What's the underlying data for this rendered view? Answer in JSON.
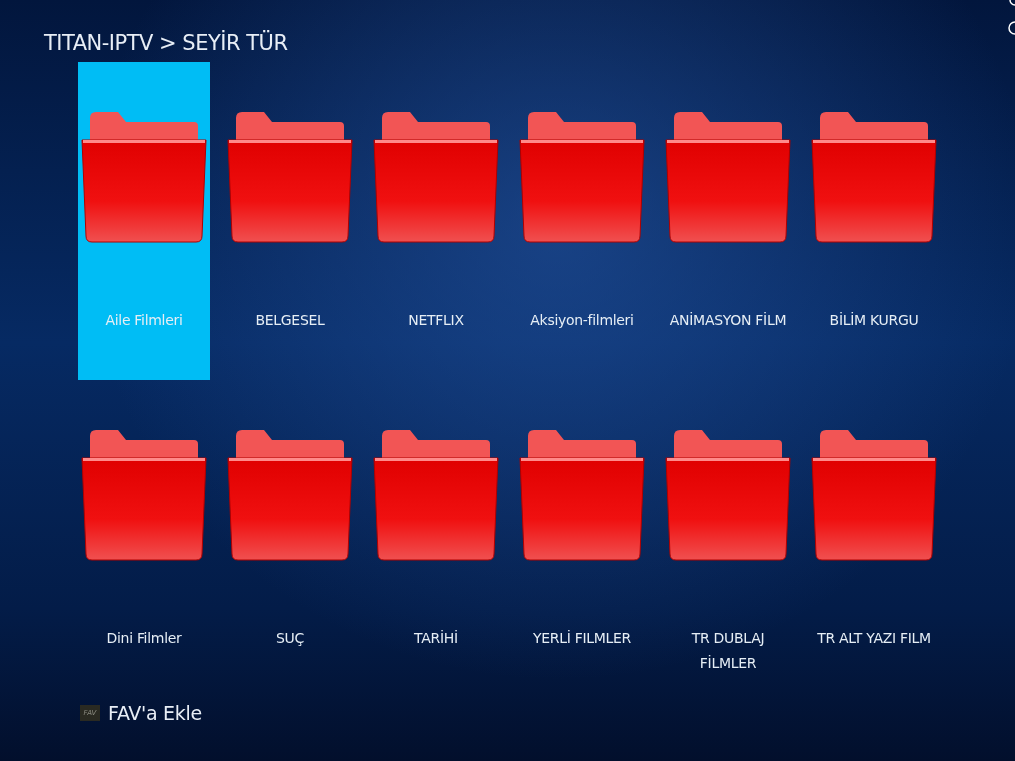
{
  "breadcrumb": "TITAN-IPTV > SEYİR TÜR",
  "categories": [
    {
      "label": "Aile Filmleri",
      "selected": true
    },
    {
      "label": "BELGESEL",
      "selected": false
    },
    {
      "label": "NETFLIX",
      "selected": false
    },
    {
      "label": "Aksiyon-filmleri",
      "selected": false
    },
    {
      "label": "ANİMASYON FİLM",
      "selected": false
    },
    {
      "label": "BİLİM KURGU",
      "selected": false
    },
    {
      "label": "Dini Filmler",
      "selected": false
    },
    {
      "label": "SUÇ",
      "selected": false
    },
    {
      "label": "TARİHİ",
      "selected": false
    },
    {
      "label": "YERLİ FILMLER",
      "selected": false
    },
    {
      "label": "TR DUBLAJ\nFİLMLER",
      "selected": false
    },
    {
      "label": "TR ALT YAZI FILM",
      "selected": false
    }
  ],
  "hint": {
    "key": "FAV",
    "label": "FAV'a Ekle"
  }
}
